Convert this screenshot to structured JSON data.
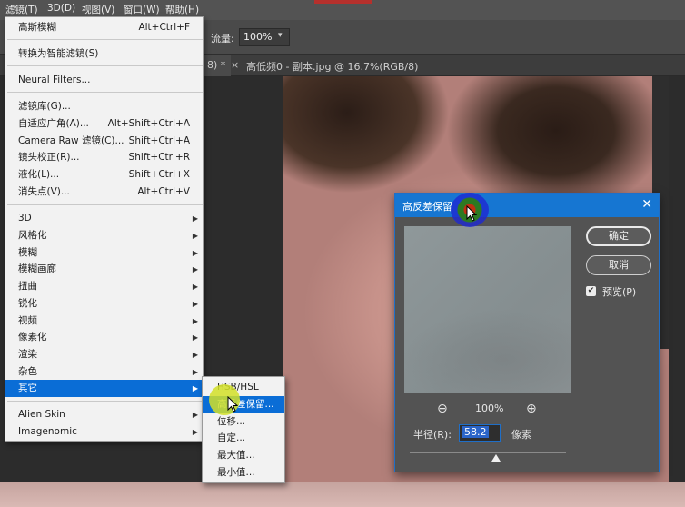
{
  "menubar": {
    "items": [
      "滤镜(T)",
      "3D(D)",
      "视图(V)",
      "窗口(W)",
      "帮助(H)"
    ]
  },
  "options_bar": {
    "flow_label": "流量:",
    "flow_value": "100%"
  },
  "document_tabs": [
    {
      "label": "8) *",
      "close": "×"
    },
    {
      "label": "高低频0 - 副本.jpg @ 16.7%(RGB/8)",
      "close": "×"
    }
  ],
  "filter_menu": {
    "items": [
      {
        "label": "高斯模糊",
        "shortcut": "Alt+Ctrl+F"
      },
      {
        "label": "转换为智能滤镜(S)",
        "shortcut": ""
      },
      {
        "label": "Neural Filters...",
        "shortcut": ""
      },
      {
        "label": "滤镜库(G)...",
        "shortcut": ""
      },
      {
        "label": "自适应广角(A)...",
        "shortcut": "Alt+Shift+Ctrl+A"
      },
      {
        "label": "Camera Raw 滤镜(C)...",
        "shortcut": "Shift+Ctrl+A"
      },
      {
        "label": "镜头校正(R)...",
        "shortcut": "Shift+Ctrl+R"
      },
      {
        "label": "液化(L)...",
        "shortcut": "Shift+Ctrl+X"
      },
      {
        "label": "消失点(V)...",
        "shortcut": "Alt+Ctrl+V"
      },
      {
        "label": "3D",
        "submenu": true
      },
      {
        "label": "风格化",
        "submenu": true
      },
      {
        "label": "模糊",
        "submenu": true
      },
      {
        "label": "模糊画廊",
        "submenu": true
      },
      {
        "label": "扭曲",
        "submenu": true
      },
      {
        "label": "锐化",
        "submenu": true
      },
      {
        "label": "视频",
        "submenu": true
      },
      {
        "label": "像素化",
        "submenu": true
      },
      {
        "label": "渲染",
        "submenu": true
      },
      {
        "label": "杂色",
        "submenu": true
      },
      {
        "label": "其它",
        "submenu": true,
        "selected": true
      },
      {
        "label": "Alien Skin",
        "submenu": true
      },
      {
        "label": "Imagenomic",
        "submenu": true
      }
    ]
  },
  "other_submenu": {
    "items": [
      "HSB/HSL",
      "高反差保留...",
      "位移...",
      "自定...",
      "最大值...",
      "最小值..."
    ],
    "highlighted": "高反差保留..."
  },
  "dialog": {
    "title": "高反差保留",
    "close": "✕",
    "ok_label": "确定",
    "cancel_label": "取消",
    "preview_label": "预览(P)",
    "preview_checked": true,
    "zoom_out_icon": "⊖",
    "zoom_in_icon": "⊕",
    "zoom_level": "100%",
    "radius_label": "半径(R):",
    "radius_value": "58.2",
    "radius_unit": "像素"
  },
  "icons": [
    "chevron-right-icon",
    "close-icon",
    "zoom-in-icon",
    "zoom-out-icon",
    "mouse-pointer-icon",
    "checkbox-icon"
  ],
  "colors": {
    "selection_blue": "#0a6dd6",
    "dialog_title_blue": "#1676d2",
    "menu_bg": "#f2f2f2",
    "dialog_bg": "#535353"
  }
}
